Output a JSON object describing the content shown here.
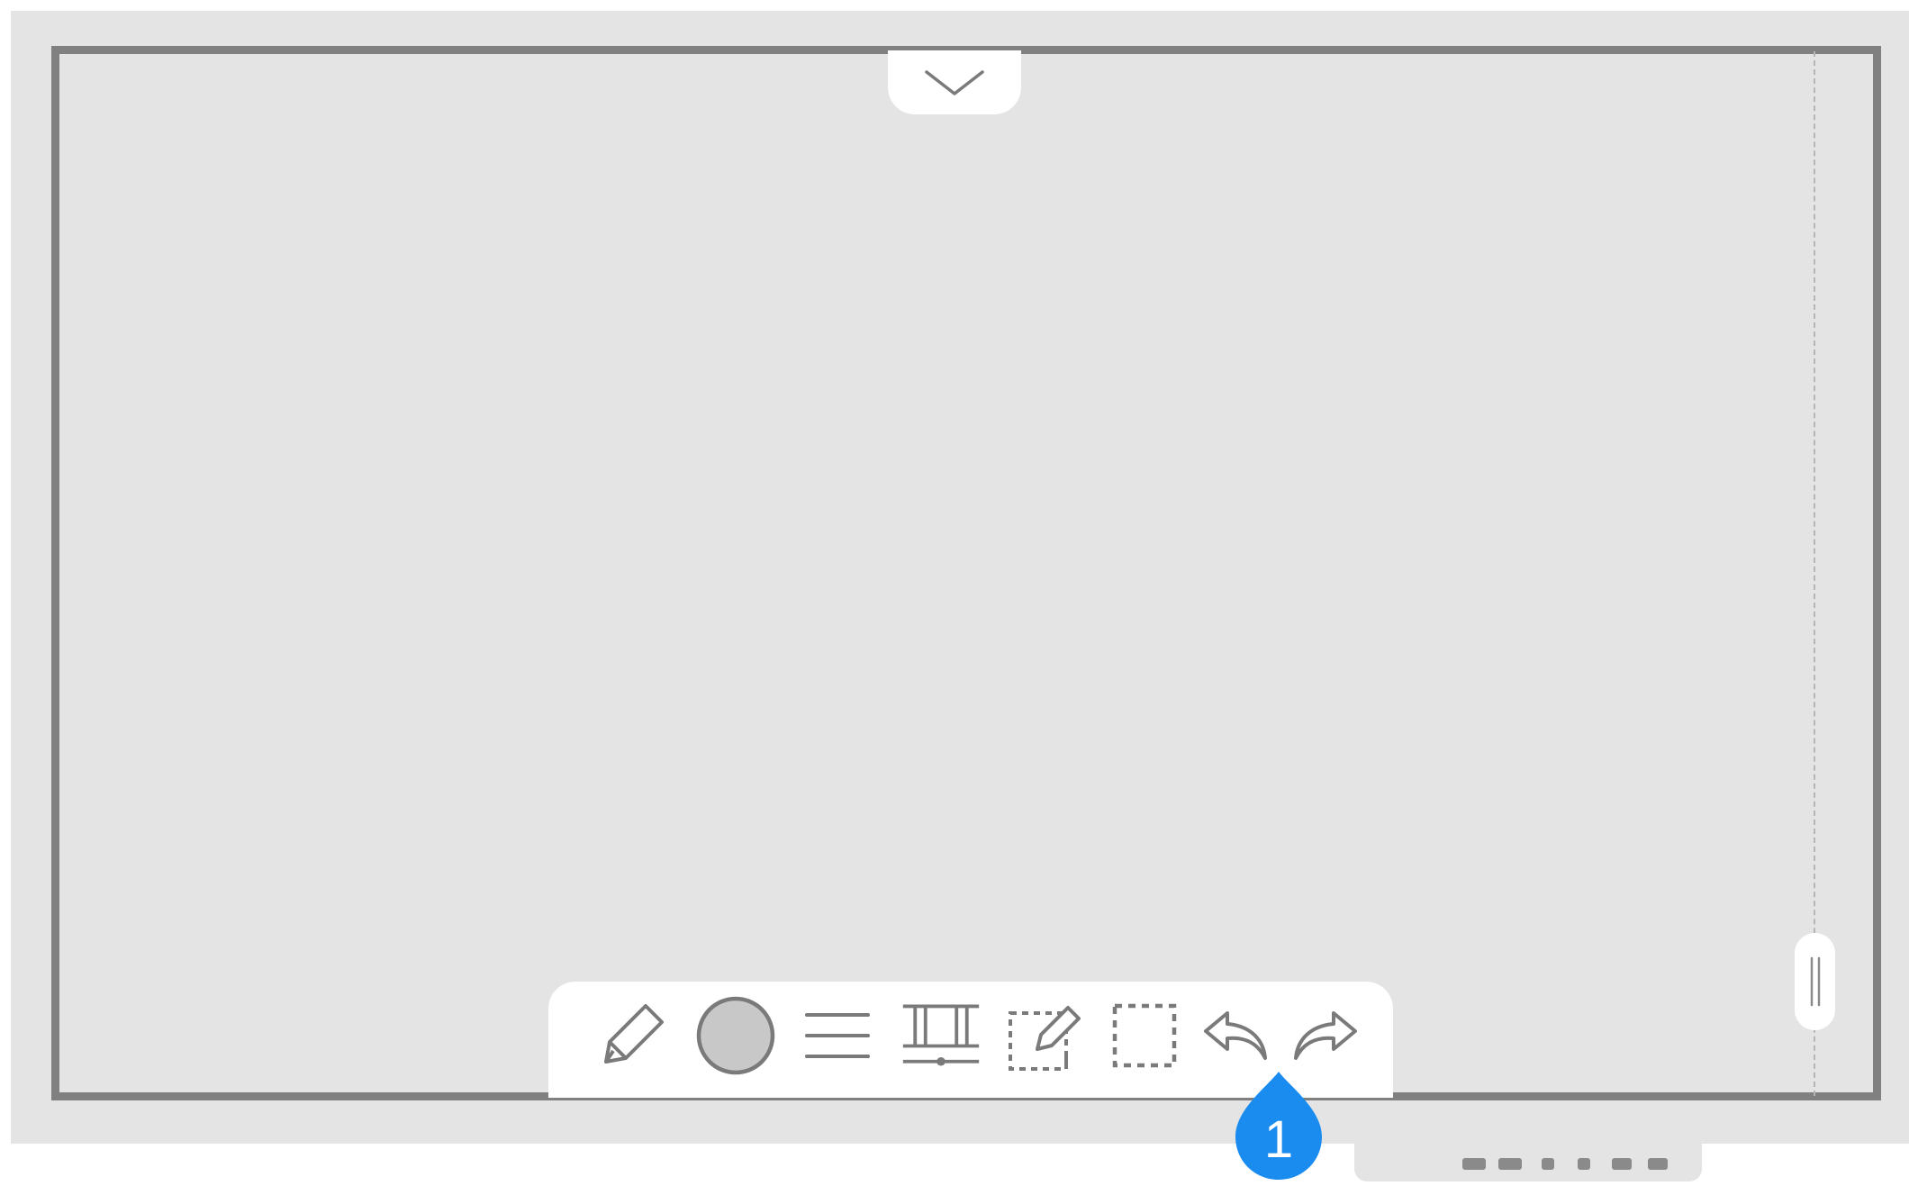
{
  "canvas": {
    "background_color": "#e4e4e4",
    "frame_color": "#808080"
  },
  "top_tab": {
    "icon": "chevron-down-icon"
  },
  "toolbar": {
    "tools": [
      {
        "name": "pen",
        "icon": "pencil-icon"
      },
      {
        "name": "color",
        "icon": "color-circle-icon",
        "color": "#c8c8c8"
      },
      {
        "name": "menu",
        "icon": "menu-lines-icon"
      },
      {
        "name": "resize",
        "icon": "resize-frame-icon"
      },
      {
        "name": "edit-selection",
        "icon": "edit-selection-icon"
      },
      {
        "name": "select",
        "icon": "dashed-select-icon"
      },
      {
        "name": "undo",
        "icon": "undo-icon"
      },
      {
        "name": "redo",
        "icon": "redo-icon"
      }
    ]
  },
  "scroll_handle": {
    "icon": "drag-handle-icon"
  },
  "callout": {
    "number": "1",
    "color": "#1a8cf0"
  },
  "bottom_dock": {
    "icon": "dock-indicator-icon"
  }
}
